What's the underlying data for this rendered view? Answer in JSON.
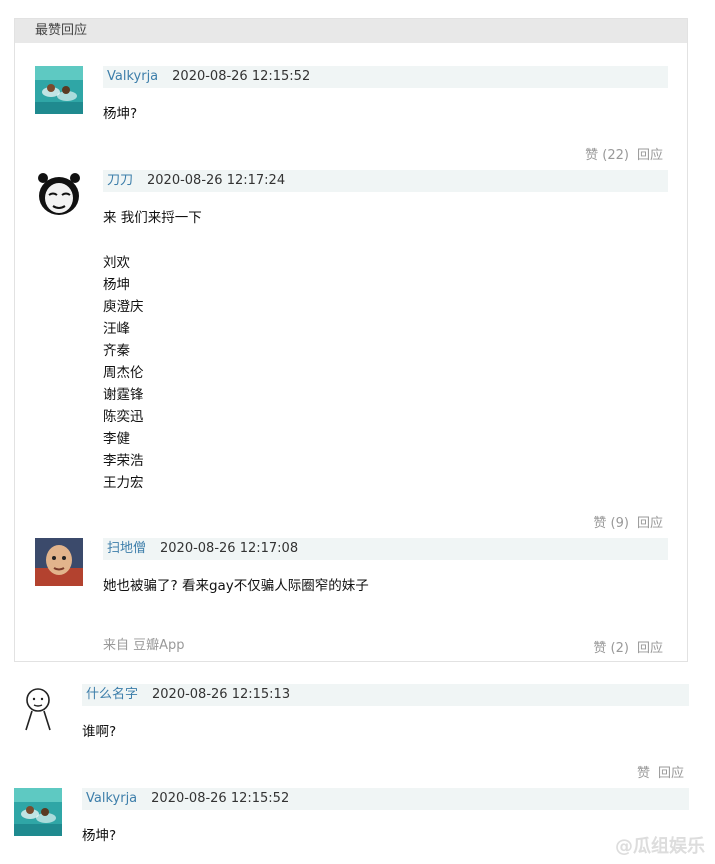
{
  "header": {
    "title": "最赞回应"
  },
  "comments": [
    {
      "user": "Valkyrja",
      "time": "2020-08-26 12:15:52",
      "text": "杨坤?",
      "like": "赞 (22)",
      "reply": "回应",
      "avatar_icon": "swimming-photo-icon"
    },
    {
      "user": "刀刀",
      "time": "2020-08-26 12:17:24",
      "text": "来 我们来捋一下",
      "names": [
        "刘欢",
        "杨坤",
        "庾澄庆",
        "汪峰",
        "齐秦",
        "周杰伦",
        "谢霆锋",
        "陈奕迅",
        "李健",
        "李荣浩",
        "王力宏"
      ],
      "like": "赞 (9)",
      "reply": "回应",
      "avatar_icon": "panda-meme-icon"
    },
    {
      "user": "扫地僧",
      "time": "2020-08-26 12:17:08",
      "text": "她也被骗了? 看来gay不仅骗人际圈窄的妹子",
      "source": "来自 豆瓣App",
      "like": "赞 (2)",
      "reply": "回应",
      "avatar_icon": "child-photo-icon"
    },
    {
      "user": "什么名字",
      "time": "2020-08-26 12:15:13",
      "text": "谁啊?",
      "like": "赞",
      "reply": "回应",
      "avatar_icon": "stick-figure-icon"
    },
    {
      "user": "Valkyrja",
      "time": "2020-08-26 12:15:52",
      "text": "杨坤?",
      "avatar_icon": "swimming-photo-icon"
    }
  ],
  "watermark": "@瓜组娱乐"
}
